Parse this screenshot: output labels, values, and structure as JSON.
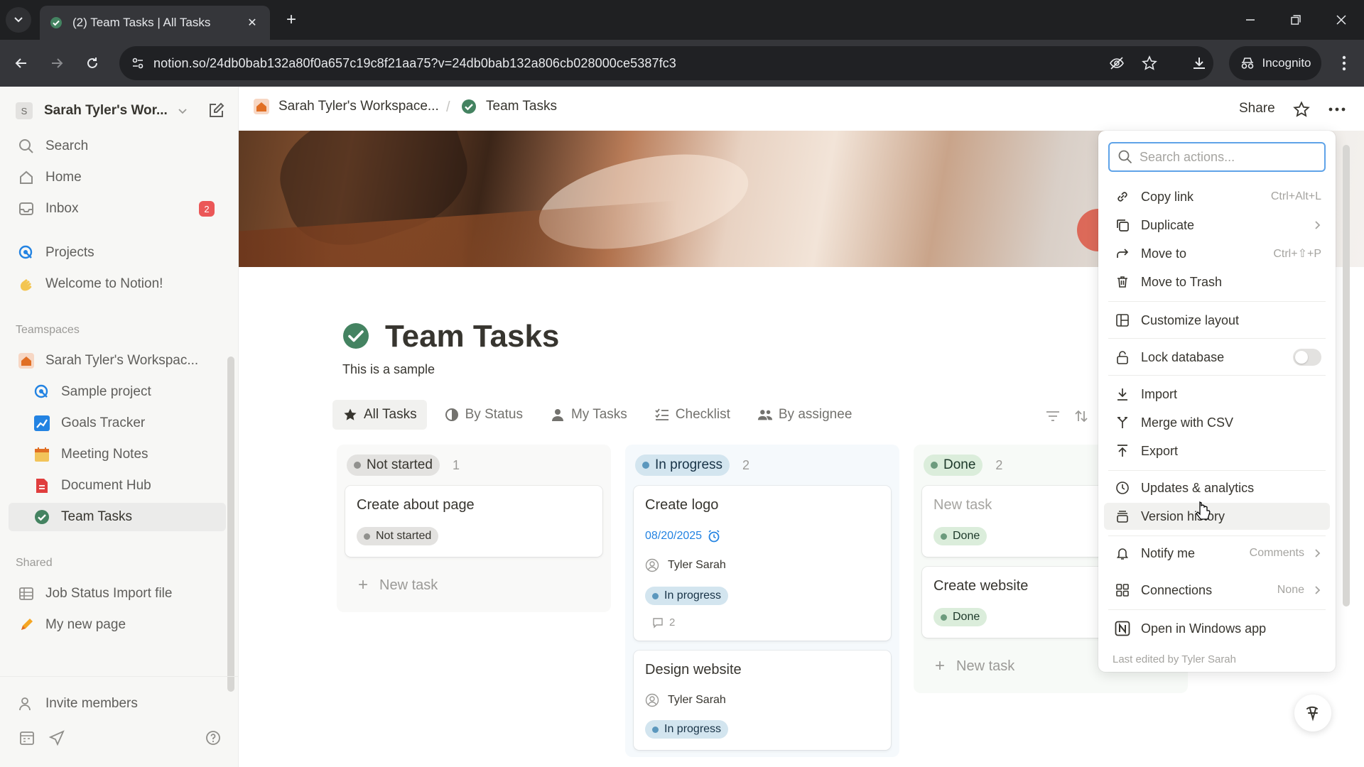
{
  "browser": {
    "tab_title": "(2) Team Tasks | All Tasks",
    "url": "notion.so/24db0bab132a80f0a657c19c8f21aa75?v=24db0bab132a806cb028000ce5387fc3",
    "incognito_label": "Incognito"
  },
  "sidebar": {
    "workspace_name": "Sarah Tyler's Wor...",
    "workspace_initial": "S",
    "top_items": [
      {
        "label": "Search",
        "icon": "search-icon"
      },
      {
        "label": "Home",
        "icon": "home-icon"
      },
      {
        "label": "Inbox",
        "icon": "inbox-icon",
        "badge": "2"
      }
    ],
    "private_items": [
      {
        "label": "Projects",
        "icon": "projects-icon"
      },
      {
        "label": "Welcome to Notion!",
        "icon": "wave-icon"
      }
    ],
    "teamspaces_label": "Teamspaces",
    "teamspace_name": "Sarah Tyler's Workspac...",
    "teamspace_items": [
      {
        "label": "Sample project"
      },
      {
        "label": "Goals Tracker"
      },
      {
        "label": "Meeting Notes"
      },
      {
        "label": "Document Hub"
      },
      {
        "label": "Team Tasks"
      }
    ],
    "shared_label": "Shared",
    "shared_items": [
      {
        "label": "Job Status Import file"
      },
      {
        "label": "My new page"
      }
    ],
    "invite_label": "Invite members"
  },
  "topbar": {
    "breadcrumb_workspace": "Sarah Tyler's Workspace...",
    "breadcrumb_page": "Team Tasks",
    "share_label": "Share"
  },
  "page": {
    "title": "Team Tasks",
    "description": "This is a sample",
    "views": [
      "All Tasks",
      "By Status",
      "My Tasks",
      "Checklist",
      "By assignee"
    ]
  },
  "board": {
    "columns": [
      {
        "status": "Not started",
        "count": "1",
        "cards": [
          {
            "title": "Create about page",
            "status": "Not started"
          }
        ],
        "new_task": "New task"
      },
      {
        "status": "In progress",
        "count": "2",
        "cards": [
          {
            "title": "Create logo",
            "date": "08/20/2025",
            "assignee": "Tyler Sarah",
            "status": "In progress",
            "comments": "2"
          },
          {
            "title": "Design website",
            "assignee": "Tyler Sarah",
            "status": "In progress"
          }
        ]
      },
      {
        "status": "Done",
        "count": "2",
        "cards": [
          {
            "title": "New task",
            "status": "Done"
          },
          {
            "title": "Create website",
            "status": "Done"
          }
        ],
        "new_task": "New task"
      }
    ]
  },
  "menu": {
    "search_placeholder": "Search actions...",
    "items": {
      "copy_link": {
        "label": "Copy link",
        "shortcut": "Ctrl+Alt+L"
      },
      "duplicate": {
        "label": "Duplicate"
      },
      "move_to": {
        "label": "Move to",
        "shortcut": "Ctrl+⇧+P"
      },
      "move_trash": {
        "label": "Move to Trash"
      },
      "customize": {
        "label": "Customize layout"
      },
      "lock": {
        "label": "Lock database"
      },
      "import": {
        "label": "Import"
      },
      "merge_csv": {
        "label": "Merge with CSV"
      },
      "export": {
        "label": "Export"
      },
      "updates": {
        "label": "Updates & analytics"
      },
      "version": {
        "label": "Version history"
      },
      "notify": {
        "label": "Notify me",
        "value": "Comments"
      },
      "connections": {
        "label": "Connections",
        "value": "None"
      },
      "open_app": {
        "label": "Open in Windows app"
      }
    },
    "footer": "Last edited by Tyler Sarah"
  },
  "colors": {
    "not_started_bg": "#e3e2e0",
    "not_started_dot": "#91918e",
    "in_progress_bg": "#d3e5ef",
    "in_progress_dot": "#5b97bd",
    "done_bg": "#dbeddb",
    "done_dot": "#6c9b7d",
    "accent": "#2383e2"
  }
}
